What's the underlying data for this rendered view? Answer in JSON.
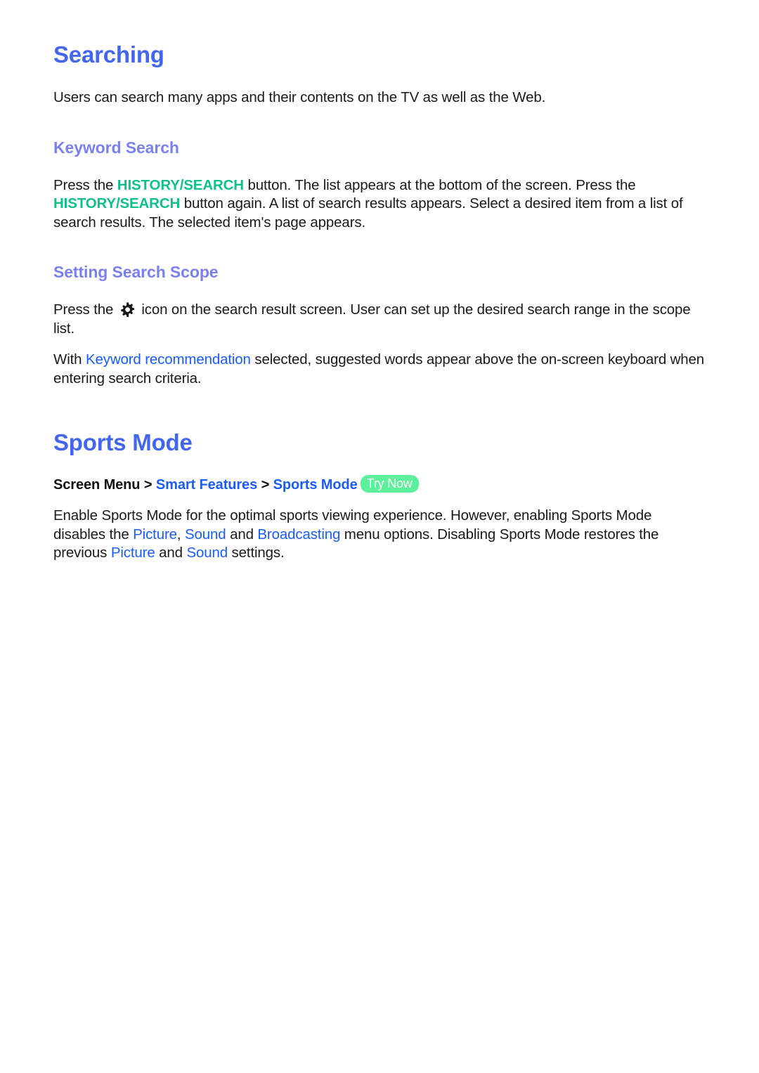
{
  "colors": {
    "h1": "#4366f0",
    "h2": "#7b80ef",
    "body": "#1a1a1a",
    "accent_teal": "#0fbf8c",
    "accent_blue": "#1a5cff",
    "badge_bg": "#5cf09a",
    "badge_text": "#ffffff",
    "page_bg": "#ffffff"
  },
  "sections": {
    "searching": {
      "title": "Searching",
      "intro": "Users can search many apps and their contents on the TV as well as the Web.",
      "keyword_search": {
        "heading": "Keyword Search",
        "text_1": "Press the ",
        "button_1": "HISTORY/SEARCH",
        "text_2": " button. The list appears at the bottom of the screen. Press the ",
        "button_2": "HISTORY/SEARCH",
        "text_3": " button again. A list of search results appears. Select a desired item from a list of search results. The selected item's page appears."
      },
      "setting_search_scope": {
        "heading": "Setting Search Scope",
        "para_1_text_1": "Press the ",
        "para_1_icon": "gear-icon",
        "para_1_text_2": " icon on the search result screen. User can set up the desired search range in the scope list.",
        "para_2_text_1": "With ",
        "para_2_link": "Keyword recommendation",
        "para_2_text_2": " selected, suggested words appear above the on-screen keyboard when entering search criteria."
      }
    },
    "sports_mode": {
      "title": "Sports Mode",
      "breadcrumb": {
        "root": "Screen Menu",
        "sep_1": " > ",
        "level_1": "Smart Features",
        "sep_2": " > ",
        "level_2": "Sports Mode",
        "badge": "Try Now"
      },
      "body": {
        "text_1": "Enable Sports Mode for the optimal sports viewing experience. However, enabling Sports Mode disables the ",
        "link_1": "Picture",
        "text_2": ", ",
        "link_2": "Sound",
        "text_3": " and ",
        "link_3": "Broadcasting",
        "text_4": " menu options. Disabling Sports Mode restores the previous ",
        "link_4": "Picture",
        "text_5": " and ",
        "link_5": "Sound",
        "text_6": " settings."
      }
    }
  }
}
